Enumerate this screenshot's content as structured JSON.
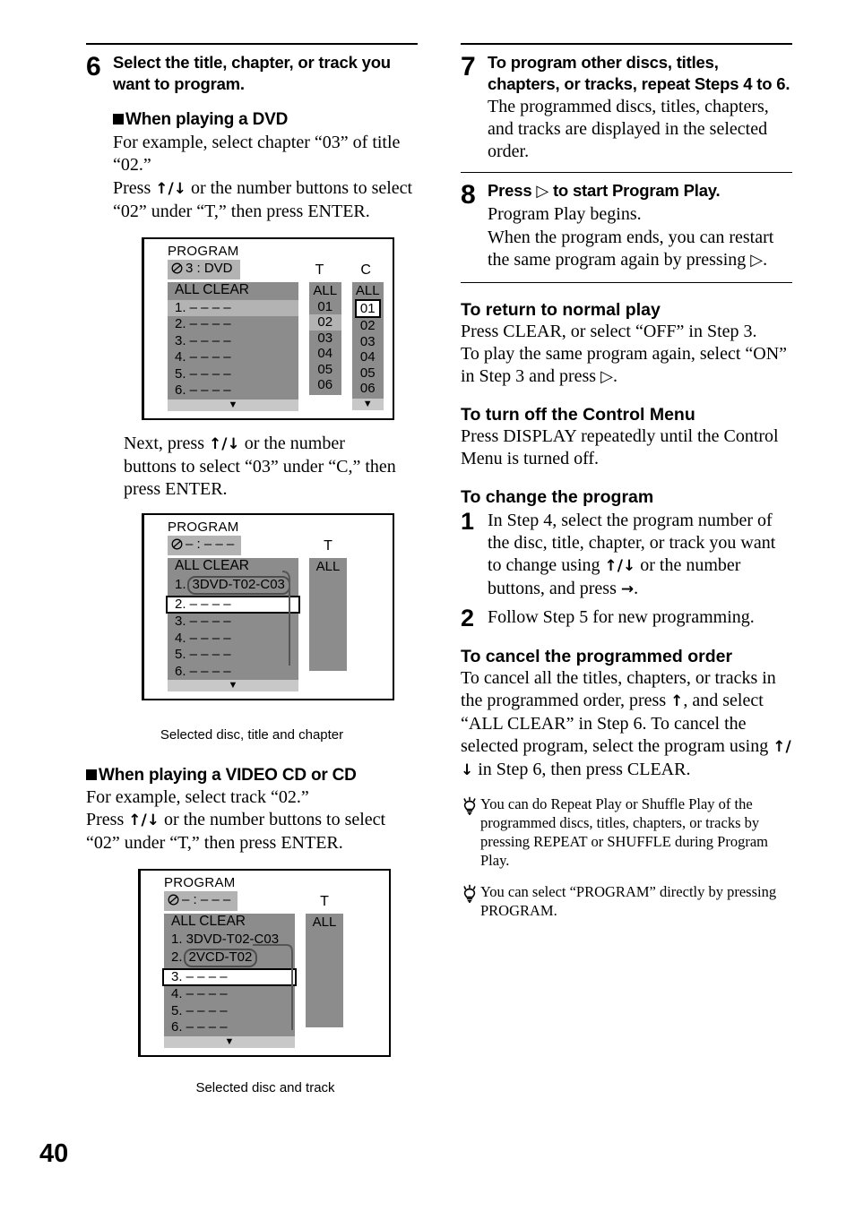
{
  "page": {
    "number": "40"
  },
  "left": {
    "step6": {
      "num": "6",
      "heading": "Select the title, chapter, or track you want to program.",
      "dvd_subhead": "When playing a DVD",
      "dvd_text_1": "For example, select chapter “03” of title “02.”",
      "dvd_text_2_a": "Press ",
      "dvd_text_2_arrows": "↑/↓",
      "dvd_text_2_b": " or the number buttons to select “02” under “T,” then press ENTER.",
      "next_text_a": "Next, press ",
      "next_text_arrows": "↑/↓",
      "next_text_b": " or the number buttons to select “03” under “C,” then press ENTER.",
      "vcd_subhead": "When playing a VIDEO CD or CD",
      "vcd_text_1": "For example, select track “02.”",
      "vcd_text_2_a": "Press ",
      "vcd_text_2_arrows": "↑/↓",
      "vcd_text_2_b": " or the number buttons to select “02” under “T,” then press ENTER."
    },
    "caption_1": "Selected disc, title and chapter",
    "caption_2": "Selected disc and track"
  },
  "osd1": {
    "title": "PROGRAM",
    "disc": "3 : DVD",
    "disc_icon": "disc-slash-icon",
    "rows": [
      "ALL CLEAR",
      "1. – – – –",
      "2. – – – –",
      "3. – – – –",
      "4. – – – –",
      "5. – – – –",
      "6. – – – –"
    ],
    "scroll": "▼",
    "col_t_header": "T",
    "col_c_header": "C",
    "col_t_values": [
      "ALL",
      "01",
      "02",
      "03",
      "04",
      "05",
      "06"
    ],
    "col_c_values": [
      "ALL",
      "01",
      "02",
      "03",
      "04",
      "05",
      "06"
    ],
    "col_t_selected": "02",
    "col_c_cursor": "01",
    "col_c_scroll": "▼"
  },
  "osd2": {
    "title": "PROGRAM",
    "disc": "– : – – –",
    "disc_icon": "disc-slash-icon",
    "row_allclear": "ALL CLEAR",
    "row1_num": "1.",
    "row1_value": "3DVD-T02-C03",
    "rows_rest": [
      "2. – – – –",
      "3. – – – –",
      "4. – – – –",
      "5. – – – –",
      "6. – – – –"
    ],
    "cursor_row": "2. – – – –",
    "scroll": "▼",
    "col_t_header": "T",
    "col_t_value": "ALL"
  },
  "osd3": {
    "title": "PROGRAM",
    "disc": "– : – – –",
    "disc_icon": "disc-slash-icon",
    "row_allclear": "ALL CLEAR",
    "row1": "1. 3DVD-T02-C03",
    "row2_num": "2.",
    "row2_value": "2VCD-T02",
    "cursor_row": "3. – – – –",
    "rows_rest": [
      "4. – – – –",
      "5. – – – –",
      "6. – – – –"
    ],
    "scroll": "▼",
    "col_t_header": "T",
    "col_t_value": "ALL"
  },
  "right": {
    "step7": {
      "num": "7",
      "heading": "To program other discs, titles, chapters, or tracks, repeat Steps 4 to 6.",
      "text": "The programmed discs, titles, chapters, and tracks are displayed in the selected order."
    },
    "step8": {
      "num": "8",
      "heading_a": "Press ",
      "heading_icon": "▷",
      "heading_b": " to start Program Play.",
      "text_1": "Program Play begins.",
      "text_2_a": "When the program ends, you can restart the same program again by pressing ",
      "text_2_icon": "▷",
      "text_2_b": "."
    },
    "normal_play": {
      "heading": "To return to normal play",
      "text_1": "Press CLEAR, or select “OFF” in Step 3.",
      "text_2_a": "To play the same program again, select “ON” in Step 3 and press ",
      "text_2_icon": "▷",
      "text_2_b": "."
    },
    "control_menu": {
      "heading": "To turn off the Control Menu",
      "text": "Press DISPLAY repeatedly until the Control Menu is turned off."
    },
    "change_program": {
      "heading": "To change the program",
      "item1_num": "1",
      "item1_a": "In Step 4, select the program number of the disc, title, chapter, or track you want to change using ",
      "item1_arrows": "↑/↓",
      "item1_b": " or the number buttons, and press ",
      "item1_arrow2": "→",
      "item1_c": ".",
      "item2_num": "2",
      "item2": "Follow Step 5 for new programming."
    },
    "cancel_order": {
      "heading": "To cancel the programmed order",
      "text_a": "To cancel all the titles, chapters, or tracks in the programmed order, press ",
      "text_arrow_up": "↑",
      "text_b": ", and select “ALL CLEAR” in Step 6. To cancel the selected program, select the program using ",
      "text_arrows": "↑/↓",
      "text_c": " in Step 6, then press CLEAR."
    },
    "tips": [
      {
        "icon": "lightbulb-icon",
        "text": "You can do Repeat Play or Shuffle Play of the programmed discs, titles, chapters, or tracks by pressing REPEAT or SHUFFLE during Program Play."
      },
      {
        "icon": "lightbulb-icon",
        "text": "You can select “PROGRAM” directly by pressing PROGRAM."
      }
    ]
  }
}
